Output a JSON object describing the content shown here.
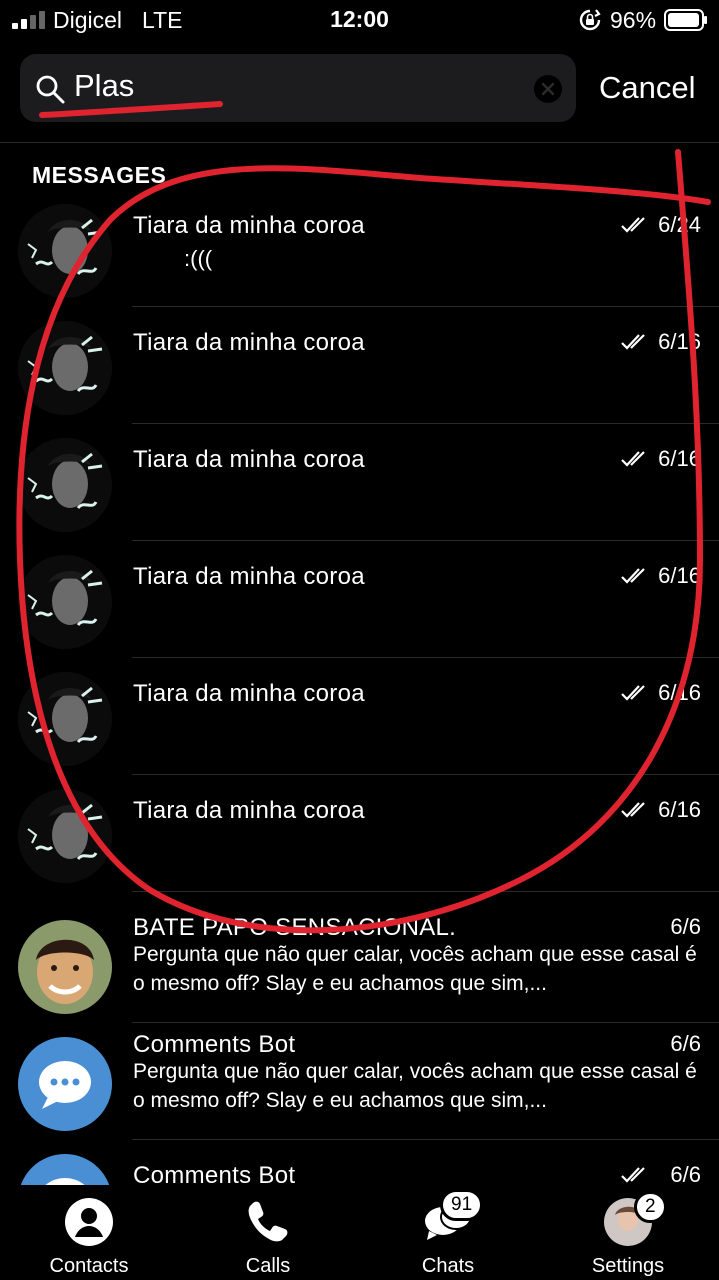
{
  "status_bar": {
    "carrier": "Digicel",
    "network": "LTE",
    "time": "12:00",
    "battery": "96%"
  },
  "search": {
    "query": "Plas",
    "cancel_label": "Cancel"
  },
  "section": {
    "title": "MESSAGES"
  },
  "messages": [
    {
      "name": "Tiara da minha coroa",
      "date": "6/24",
      "preview": ":(((",
      "read": true
    },
    {
      "name": "Tiara da minha coroa",
      "date": "6/16",
      "preview": "",
      "read": true
    },
    {
      "name": "Tiara da minha coroa",
      "date": "6/16",
      "preview": "",
      "read": true
    },
    {
      "name": "Tiara da minha coroa",
      "date": "6/16",
      "preview": "",
      "read": true
    },
    {
      "name": "Tiara da minha coroa",
      "date": "6/16",
      "preview": "",
      "read": true
    },
    {
      "name": "Tiara da minha coroa",
      "date": "6/16",
      "preview": "",
      "read": true
    },
    {
      "name": "BATE PAPO SENSACIONAL.",
      "date": "6/6",
      "preview": "Pergunta que não quer calar, vocês acham que esse casal é o mesmo off? Slay e eu achamos que sim,...",
      "read": false
    },
    {
      "name": "Comments Bot",
      "date": "6/6",
      "preview": "Pergunta que não quer calar, vocês acham que esse casal é o mesmo off? Slay e eu achamos que sim,...",
      "read": false
    },
    {
      "name": "Comments Bot",
      "date": "6/6",
      "preview": "",
      "read": true
    }
  ],
  "tabs": [
    {
      "label": "Contacts",
      "icon": "person-circle-icon"
    },
    {
      "label": "Calls",
      "icon": "phone-icon"
    },
    {
      "label": "Chats",
      "icon": "chat-bubbles-icon",
      "badge": "91"
    },
    {
      "label": "Settings",
      "icon": "profile-photo",
      "badge": "2"
    }
  ],
  "colors": {
    "background": "#000000",
    "search_field": "#1c1c1e",
    "annotation": "#e0242f",
    "bot_avatar": "#4a8fd4"
  }
}
